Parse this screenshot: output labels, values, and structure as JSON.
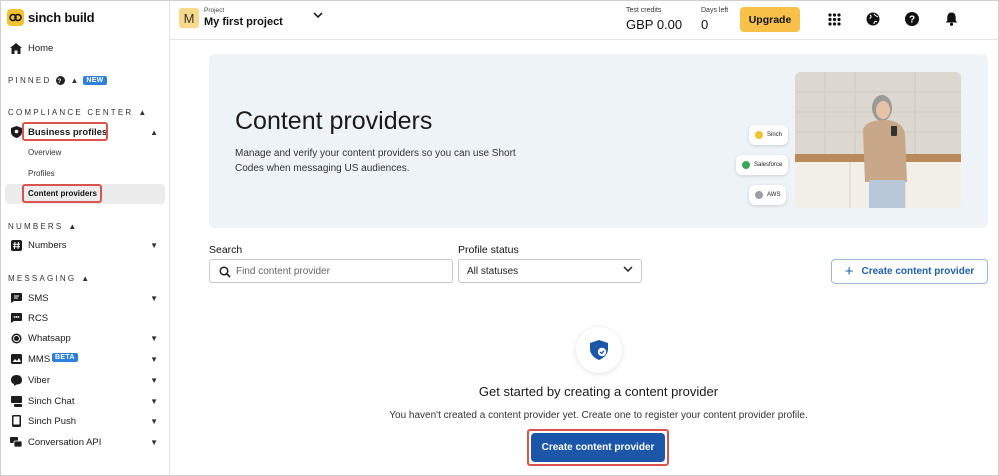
{
  "brand": {
    "name": "sinch build"
  },
  "project": {
    "caption": "Project",
    "avatar_letter": "M",
    "name": "My first project"
  },
  "credits": {
    "caption": "Test credits",
    "value": "GBP 0.00"
  },
  "days": {
    "caption": "Days left",
    "value": "0"
  },
  "upgrade_label": "Upgrade",
  "sidebar": {
    "home": "Home",
    "pinned": {
      "label": "PINNED",
      "badge": "NEW"
    },
    "compliance": {
      "label": "COMPLIANCE CENTER",
      "business_profiles": "Business profiles",
      "overview": "Overview",
      "profiles": "Profiles",
      "content_providers": "Content providers"
    },
    "numbers": {
      "label": "NUMBERS",
      "item": "Numbers"
    },
    "messaging": {
      "label": "MESSAGING",
      "items": [
        {
          "label": "SMS",
          "icon": "sms-icon"
        },
        {
          "label": "RCS",
          "icon": "rcs-icon"
        },
        {
          "label": "Whatsapp",
          "icon": "whatsapp-icon"
        },
        {
          "label": "MMS",
          "icon": "mms-icon",
          "badge": "BETA"
        },
        {
          "label": "Viber",
          "icon": "viber-icon"
        },
        {
          "label": "Sinch Chat",
          "icon": "chat-icon"
        },
        {
          "label": "Sinch Push",
          "icon": "push-icon"
        },
        {
          "label": "Conversation API",
          "icon": "conversation-icon"
        }
      ]
    }
  },
  "hero": {
    "title": "Content providers",
    "description": "Manage and verify your content providers so you can use Short Codes when messaging US audiences.",
    "chips": [
      "Sinch",
      "Salesforce",
      "AWS"
    ]
  },
  "filters": {
    "search_label": "Search",
    "search_placeholder": "Find content provider",
    "status_label": "Profile status",
    "status_value": "All statuses",
    "create_label": "Create content provider"
  },
  "empty_state": {
    "title": "Get started by creating a content provider",
    "description": "You haven't created a content provider yet. Create one to register your content provider profile.",
    "button": "Create content provider"
  },
  "colors": {
    "accent": "#1b56a8",
    "upgrade": "#f7c14a",
    "highlight": "#d9534f",
    "hero_bg": "#eef3f8"
  }
}
